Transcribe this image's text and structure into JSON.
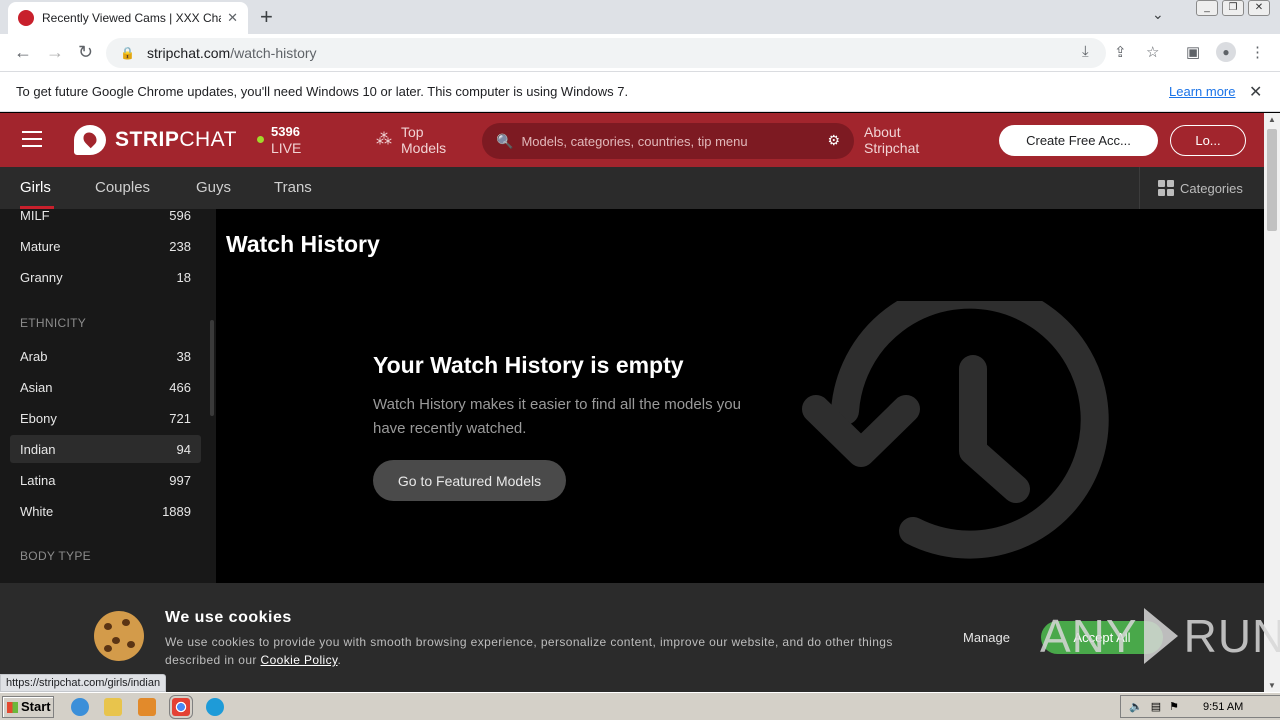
{
  "browser": {
    "tab_title": "Recently Viewed Cams | XXX Chat, F",
    "tab_close": "✕",
    "new_tab": "+",
    "url_domain": "stripchat.com",
    "url_path": "/watch-history",
    "infobar_text": "To get future Google Chrome updates, you'll need Windows 10 or later. This computer is using Windows 7.",
    "infobar_link": "Learn more",
    "status_url": "https://stripchat.com/girls/indian"
  },
  "header": {
    "logo_bold": "STRIP",
    "logo_thin": "CHAT",
    "live_count": "5396",
    "live_label": "LIVE",
    "top_models_line1": "Top",
    "top_models_line2": "Models",
    "search_placeholder": "Models, categories, countries, tip menu",
    "about_line1": "About",
    "about_line2": "Stripchat",
    "create_account": "Create Free Acc...",
    "login": "Lo..."
  },
  "catnav": {
    "items": [
      "Girls",
      "Couples",
      "Guys",
      "Trans"
    ],
    "categories": "Categories"
  },
  "sidebar": {
    "age_items": [
      {
        "label": "MILF",
        "count": "596"
      },
      {
        "label": "Mature",
        "count": "238"
      },
      {
        "label": "Granny",
        "count": "18"
      }
    ],
    "ethnicity_heading": "ETHNICITY",
    "ethnicity_items": [
      {
        "label": "Arab",
        "count": "38"
      },
      {
        "label": "Asian",
        "count": "466"
      },
      {
        "label": "Ebony",
        "count": "721"
      },
      {
        "label": "Indian",
        "count": "94"
      },
      {
        "label": "Latina",
        "count": "997"
      },
      {
        "label": "White",
        "count": "1889"
      }
    ],
    "bodytype_heading": "BODY TYPE"
  },
  "main": {
    "page_title": "Watch History",
    "empty_title": "Your Watch History is empty",
    "empty_desc": "Watch History makes it easier to find all the models you have recently watched.",
    "featured_button": "Go to Featured Models"
  },
  "cookie": {
    "title": "We use cookies",
    "text": "We use cookies to provide you with smooth browsing experience, personalize content, improve our website, and do other things described in our",
    "policy_link": "Cookie Policy",
    "manage": "Manage",
    "accept": "Accept All"
  },
  "watermark": {
    "left": "ANY",
    "right": "RUN"
  },
  "taskbar": {
    "start": "Start",
    "clock": "9:51 AM"
  },
  "colors": {
    "brand": "#a2252d",
    "accent_green": "#49a84a",
    "live_dot": "#a2d82b"
  }
}
